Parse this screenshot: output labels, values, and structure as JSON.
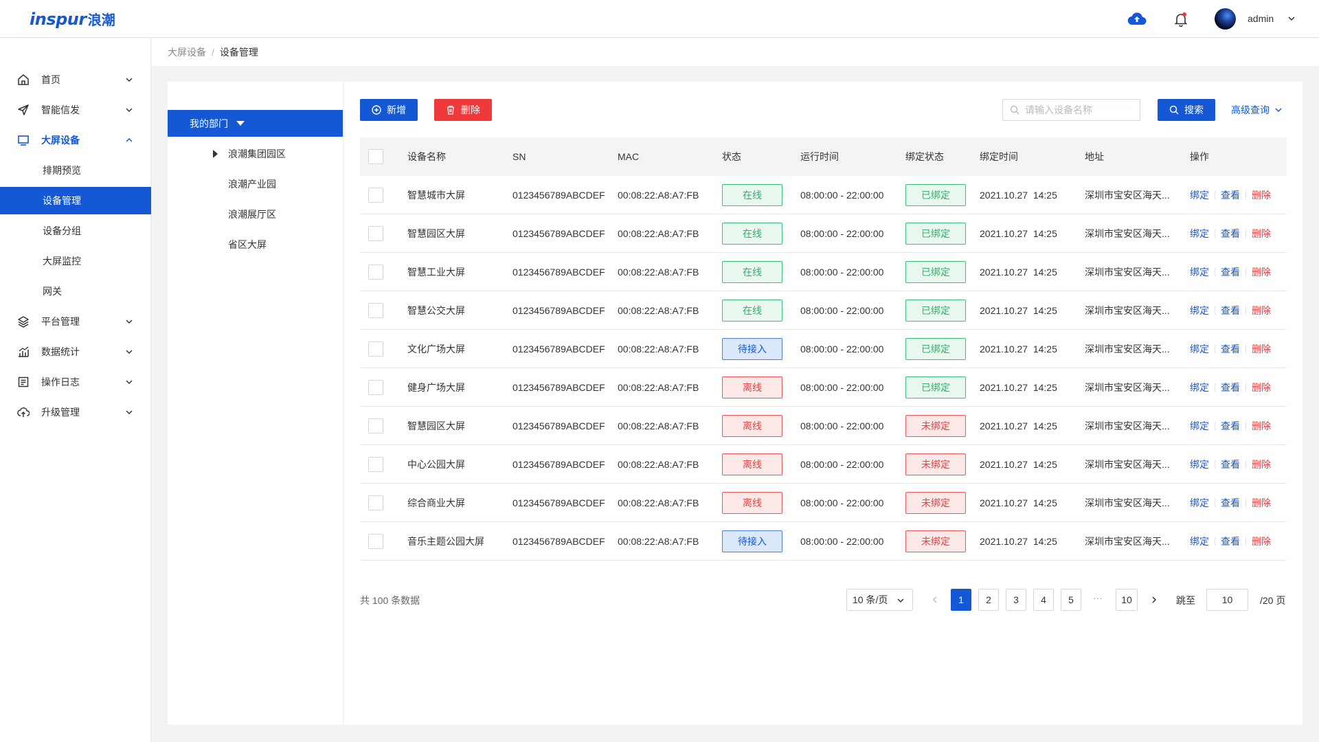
{
  "header": {
    "logo_latin": "inspur",
    "logo_cjk": "浪潮",
    "username": "admin"
  },
  "sidebar": {
    "items": [
      {
        "label": "首页",
        "icon": "home-icon"
      },
      {
        "label": "智能信发",
        "icon": "send-icon"
      },
      {
        "label": "大屏设备",
        "icon": "monitor-icon",
        "expanded": true,
        "children": [
          {
            "label": "排期预览"
          },
          {
            "label": "设备管理",
            "active": true
          },
          {
            "label": "设备分组"
          },
          {
            "label": "大屏监控"
          },
          {
            "label": "网关"
          }
        ]
      },
      {
        "label": "平台管理",
        "icon": "layers-icon"
      },
      {
        "label": "数据统计",
        "icon": "chart-icon"
      },
      {
        "label": "操作日志",
        "icon": "log-icon"
      },
      {
        "label": "升级管理",
        "icon": "cloud-upgrade-icon"
      }
    ]
  },
  "breadcrumb": {
    "parent": "大屏设备",
    "separator": "/",
    "current": "设备管理"
  },
  "tree": {
    "root": "我的部门",
    "nodes": [
      "浪潮集团园区",
      "浪潮产业园",
      "浪潮展厅区",
      "省区大屏"
    ]
  },
  "toolbar": {
    "add_label": "新增",
    "delete_label": "删除",
    "search_placeholder": "请输入设备名称",
    "search_label": "搜索",
    "advanced_label": "高级查询"
  },
  "table": {
    "headers": [
      "设备名称",
      "SN",
      "MAC",
      "状态",
      "运行时间",
      "绑定状态",
      "绑定时间",
      "地址",
      "操作"
    ],
    "rows": [
      {
        "name": "智慧城市大屏",
        "sn": "0123456789ABCDEF",
        "mac": "00:08:22:A8:A7:FB",
        "status": "在线",
        "status_color": "green",
        "runtime": "08:00:00 - 22:00:00",
        "bind": "已绑定",
        "bind_color": "green",
        "bind_time": "2021.10.27  14:25",
        "address": "深圳市宝安区海天..."
      },
      {
        "name": "智慧园区大屏",
        "sn": "0123456789ABCDEF",
        "mac": "00:08:22:A8:A7:FB",
        "status": "在线",
        "status_color": "green",
        "runtime": "08:00:00 - 22:00:00",
        "bind": "已绑定",
        "bind_color": "green",
        "bind_time": "2021.10.27  14:25",
        "address": "深圳市宝安区海天..."
      },
      {
        "name": "智慧工业大屏",
        "sn": "0123456789ABCDEF",
        "mac": "00:08:22:A8:A7:FB",
        "status": "在线",
        "status_color": "green",
        "runtime": "08:00:00 - 22:00:00",
        "bind": "已绑定",
        "bind_color": "green",
        "bind_time": "2021.10.27  14:25",
        "address": "深圳市宝安区海天..."
      },
      {
        "name": "智慧公交大屏",
        "sn": "0123456789ABCDEF",
        "mac": "00:08:22:A8:A7:FB",
        "status": "在线",
        "status_color": "green",
        "runtime": "08:00:00 - 22:00:00",
        "bind": "已绑定",
        "bind_color": "green",
        "bind_time": "2021.10.27  14:25",
        "address": "深圳市宝安区海天..."
      },
      {
        "name": "文化广场大屏",
        "sn": "0123456789ABCDEF",
        "mac": "00:08:22:A8:A7:FB",
        "status": "待接入",
        "status_color": "blue",
        "runtime": "08:00:00 - 22:00:00",
        "bind": "已绑定",
        "bind_color": "green",
        "bind_time": "2021.10.27  14:25",
        "address": "深圳市宝安区海天..."
      },
      {
        "name": "健身广场大屏",
        "sn": "0123456789ABCDEF",
        "mac": "00:08:22:A8:A7:FB",
        "status": "离线",
        "status_color": "red",
        "runtime": "08:00:00 - 22:00:00",
        "bind": "已绑定",
        "bind_color": "green",
        "bind_time": "2021.10.27  14:25",
        "address": "深圳市宝安区海天..."
      },
      {
        "name": "智慧园区大屏",
        "sn": "0123456789ABCDEF",
        "mac": "00:08:22:A8:A7:FB",
        "status": "离线",
        "status_color": "red",
        "runtime": "08:00:00 - 22:00:00",
        "bind": "未绑定",
        "bind_color": "red",
        "bind_time": "2021.10.27  14:25",
        "address": "深圳市宝安区海天..."
      },
      {
        "name": "中心公园大屏",
        "sn": "0123456789ABCDEF",
        "mac": "00:08:22:A8:A7:FB",
        "status": "离线",
        "status_color": "red",
        "runtime": "08:00:00 - 22:00:00",
        "bind": "未绑定",
        "bind_color": "red",
        "bind_time": "2021.10.27  14:25",
        "address": "深圳市宝安区海天..."
      },
      {
        "name": "综合商业大屏",
        "sn": "0123456789ABCDEF",
        "mac": "00:08:22:A8:A7:FB",
        "status": "离线",
        "status_color": "red",
        "runtime": "08:00:00 - 22:00:00",
        "bind": "未绑定",
        "bind_color": "red",
        "bind_time": "2021.10.27  14:25",
        "address": "深圳市宝安区海天..."
      },
      {
        "name": "音乐主题公园大屏",
        "sn": "0123456789ABCDEF",
        "mac": "00:08:22:A8:A7:FB",
        "status": "待接入",
        "status_color": "blue",
        "runtime": "08:00:00 - 22:00:00",
        "bind": "未绑定",
        "bind_color": "red",
        "bind_time": "2021.10.27  14:25",
        "address": "深圳市宝安区海天..."
      }
    ],
    "actions": {
      "bind": "绑定",
      "view": "查看",
      "delete": "删除"
    }
  },
  "pagination": {
    "total_text": "共 100 条数据",
    "page_size": "10 条/页",
    "pages": [
      "1",
      "2",
      "3",
      "4",
      "5"
    ],
    "ellipsis": "···",
    "last_page": "10",
    "current_page": "1",
    "jump_label": "跳至",
    "jump_value": "10",
    "total_pages": "/20 页"
  },
  "colors": {
    "primary": "#1458d6",
    "danger": "#f0393b",
    "success": "#2fb06b"
  }
}
